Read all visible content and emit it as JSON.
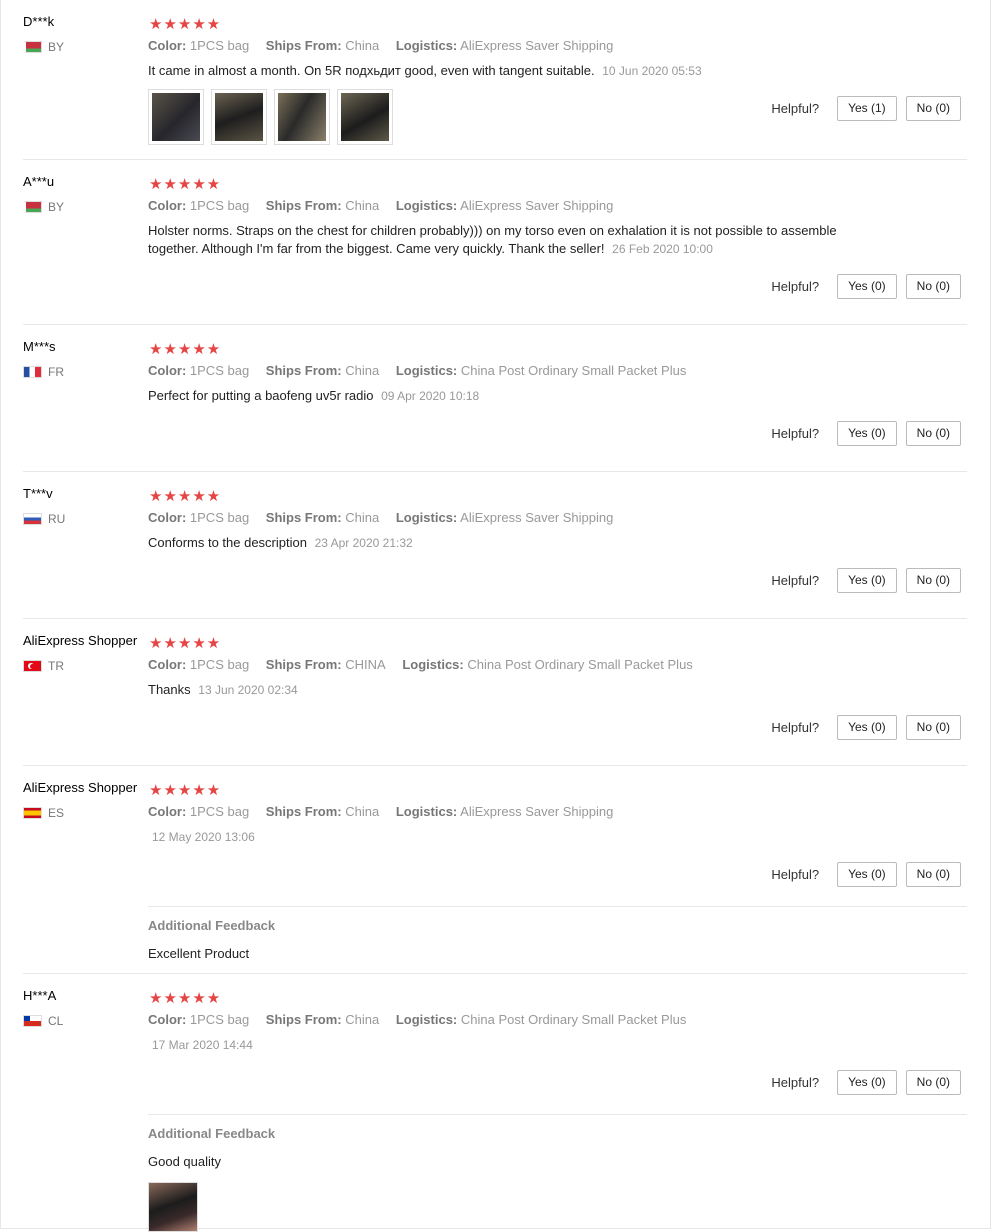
{
  "labels": {
    "color": "Color:",
    "ships_from": "Ships From:",
    "logistics": "Logistics:",
    "helpful": "Helpful?",
    "additional_feedback": "Additional Feedback"
  },
  "star_color": "#e64545",
  "reviews": [
    {
      "user": "D***k",
      "country": "BY",
      "flag": "belarus-flag",
      "rating": 5,
      "stars": "★★★★★",
      "color": "1PCS bag",
      "ships_from": "China",
      "logistics": "AliExpress Saver Shipping",
      "text": "It came in almost a month. On 5R подхьдит good, even with tangent suitable.",
      "date": "10 Jun 2020 05:53",
      "yes": "Yes (1)",
      "no": "No (0)",
      "photo_count": 4
    },
    {
      "user": "A***u",
      "country": "BY",
      "flag": "belarus-flag",
      "rating": 5,
      "stars": "★★★★★",
      "color": "1PCS bag",
      "ships_from": "China",
      "logistics": "AliExpress Saver Shipping",
      "text": "Holster norms. Straps on the chest for children probably))) on my torso even on exhalation it is not possible to assemble together. Although I'm far from the biggest. Came very quickly. Thank the seller!",
      "date": "26 Feb 2020 10:00",
      "yes": "Yes (0)",
      "no": "No (0)"
    },
    {
      "user": "M***s",
      "country": "FR",
      "flag": "france-flag",
      "rating": 5,
      "stars": "★★★★★",
      "color": "1PCS bag",
      "ships_from": "China",
      "logistics": "China Post Ordinary Small Packet Plus",
      "text": "Perfect for putting a baofeng uv5r radio",
      "date": "09 Apr 2020 10:18",
      "yes": "Yes (0)",
      "no": "No (0)"
    },
    {
      "user": "T***v",
      "country": "RU",
      "flag": "russia-flag",
      "rating": 5,
      "stars": "★★★★★",
      "color": "1PCS bag",
      "ships_from": "China",
      "logistics": "AliExpress Saver Shipping",
      "text": "Conforms to the description",
      "date": "23 Apr 2020 21:32",
      "yes": "Yes (0)",
      "no": "No (0)"
    },
    {
      "user": "AliExpress Shopper",
      "country": "TR",
      "flag": "turkey-flag",
      "rating": 5,
      "stars": "★★★★★",
      "color": "1PCS bag",
      "ships_from": "CHINA",
      "logistics": "China Post Ordinary Small Packet Plus",
      "text": "Thanks",
      "date": "13 Jun 2020 02:34",
      "yes": "Yes (0)",
      "no": "No (0)"
    },
    {
      "user": "AliExpress Shopper",
      "country": "ES",
      "flag": "spain-flag",
      "rating": 5,
      "stars": "★★★★★",
      "color": "1PCS bag",
      "ships_from": "China",
      "logistics": "AliExpress Saver Shipping",
      "text": "",
      "date": "12 May 2020 13:06",
      "yes": "Yes (0)",
      "no": "No (0)",
      "additional_feedback": "Excellent Product"
    },
    {
      "user": "H***A",
      "country": "CL",
      "flag": "chile-flag",
      "rating": 5,
      "stars": "★★★★★",
      "color": "1PCS bag",
      "ships_from": "China",
      "logistics": "China Post Ordinary Small Packet Plus",
      "text": "",
      "date": "17 Mar 2020 14:44",
      "yes": "Yes (0)",
      "no": "No (0)",
      "additional_feedback": "Good quality",
      "photo_count": 1
    }
  ]
}
